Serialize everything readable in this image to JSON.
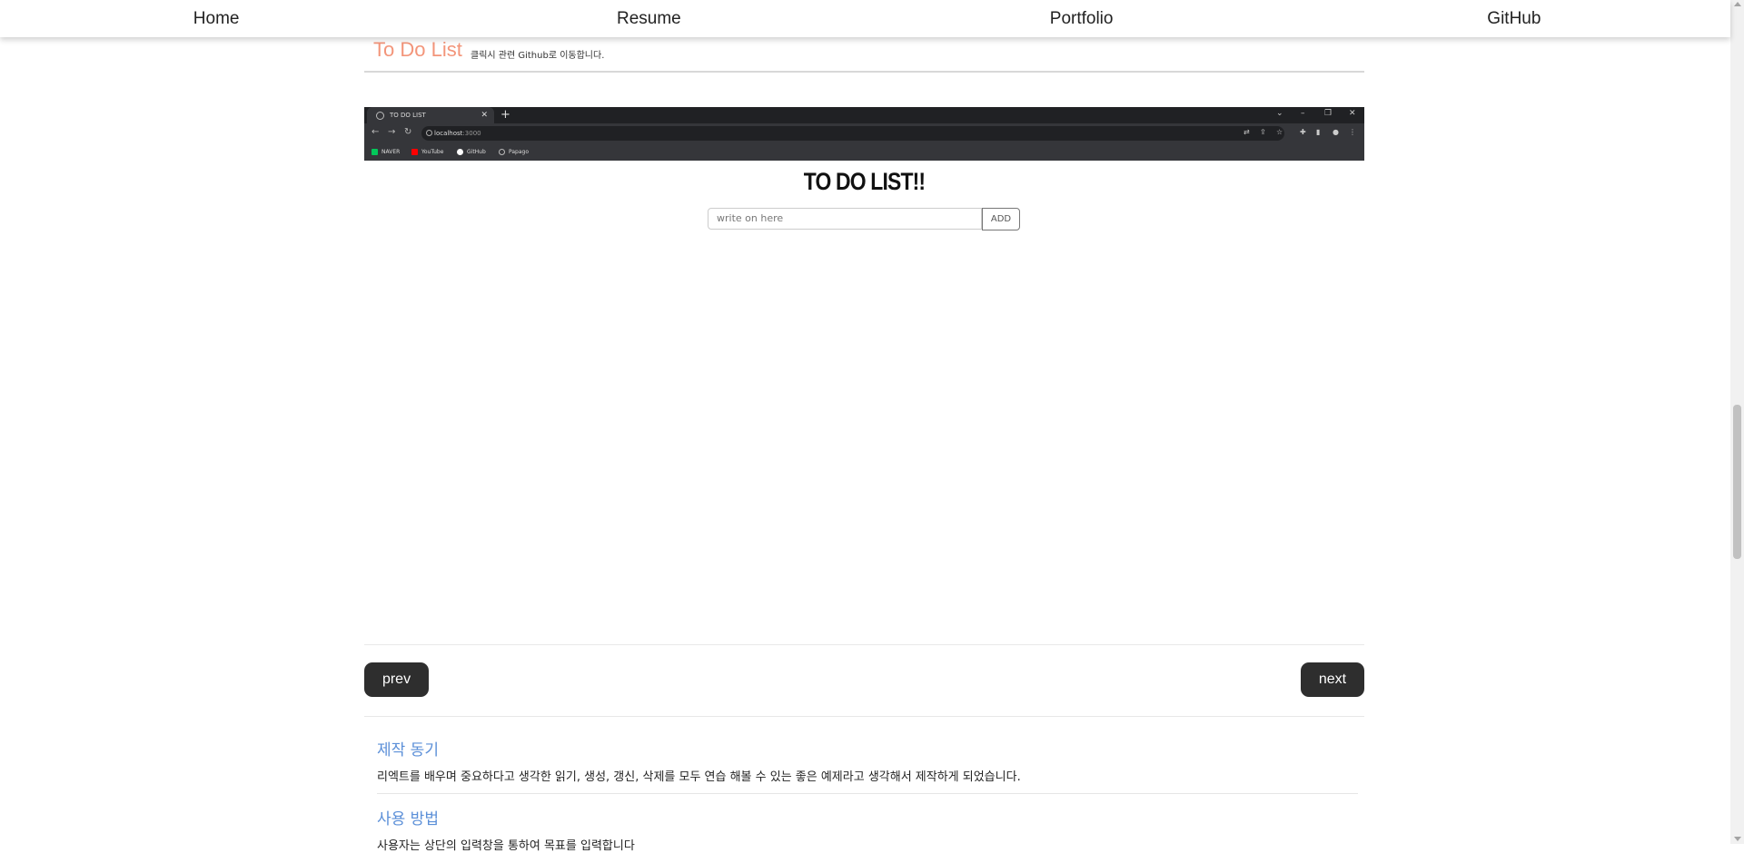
{
  "nav": {
    "items": [
      {
        "label": "Home"
      },
      {
        "label": "Resume"
      },
      {
        "label": "Portfolio"
      },
      {
        "label": "GitHub"
      }
    ]
  },
  "project": {
    "title": "To Do List",
    "subtitle": "클릭시 관련 Github로 이동합니다."
  },
  "screenshot": {
    "tab_title": "TO DO LIST",
    "address": "localhost",
    "address_port": ":3000",
    "bookmarks": [
      {
        "label": "NAVER",
        "color": "#03c75a"
      },
      {
        "label": "YouTube",
        "color": "#ff0000"
      },
      {
        "label": "GitHub",
        "color": "#ffffff"
      },
      {
        "label": "Papago",
        "color": "#bbbbbb"
      }
    ],
    "app_title": "TO DO LIST!!",
    "input_placeholder": "write on here",
    "add_label": "ADD"
  },
  "pager": {
    "prev_label": "prev",
    "next_label": "next"
  },
  "sections": [
    {
      "title": "제작 동기",
      "body": "리엑트를 배우며 중요하다고 생각한 읽기, 생성, 갱신, 삭제를 모두 연습 해볼 수 있는 좋은 예제라고 생각해서 제작하게 되었습니다."
    },
    {
      "title": "사용 방법",
      "body": "사용자는 상단의 입력창을 통하여 목표를 입력합니다"
    }
  ],
  "colors": {
    "accent_title": "#f3957a",
    "section_title": "#5b8fd8",
    "button_bg": "#2e2e2e"
  }
}
